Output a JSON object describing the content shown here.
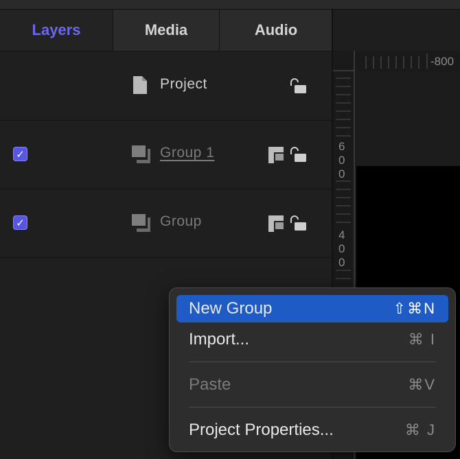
{
  "tabs": [
    {
      "label": "Layers",
      "active": true
    },
    {
      "label": "Media",
      "active": false
    },
    {
      "label": "Audio",
      "active": false
    }
  ],
  "layers": [
    {
      "name": "Project",
      "icon": "document-icon",
      "checkbox": false,
      "dimmed": false
    },
    {
      "name": "Group 1",
      "icon": "group-icon",
      "checkbox": true,
      "checked": true,
      "dimmed": true,
      "underlined": true
    },
    {
      "name": "Group",
      "icon": "group-icon",
      "checkbox": true,
      "checked": true,
      "dimmed": true
    }
  ],
  "checkmark": "✓",
  "ruler": {
    "top_label": "-800",
    "left_digits_1": [
      "6",
      "0",
      "0"
    ],
    "left_digits_2": [
      "4",
      "0",
      "0"
    ]
  },
  "context_menu": {
    "items": [
      {
        "label": "New Group",
        "shortcut": "⇧⌘N",
        "highlighted": true
      },
      {
        "label": "Import...",
        "shortcut": "⌘ I"
      },
      {
        "label": "Paste",
        "shortcut": "⌘V",
        "disabled": true
      },
      {
        "label": "Project Properties...",
        "shortcut": "⌘ J"
      }
    ]
  },
  "colors": {
    "accent": "#6b67f2",
    "highlight": "#1f5bc4",
    "checkbox": "#5856e0"
  }
}
